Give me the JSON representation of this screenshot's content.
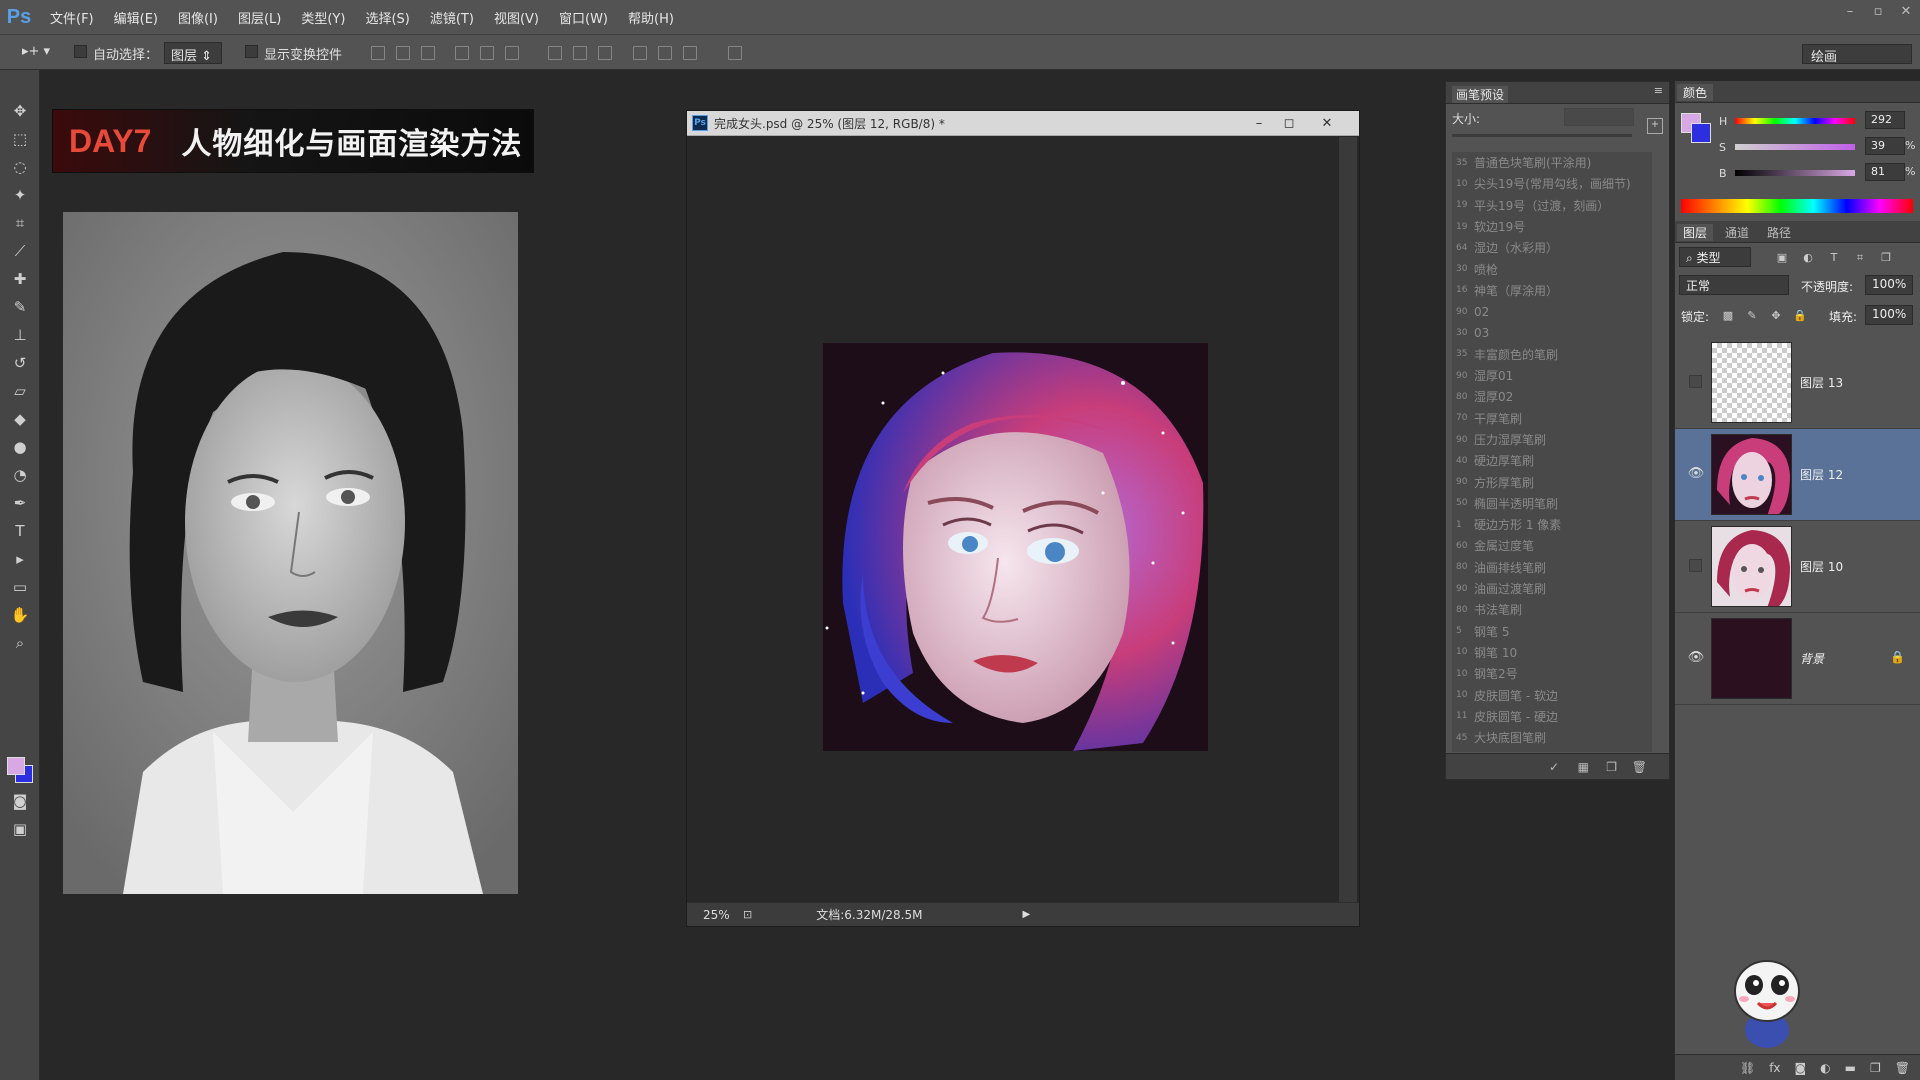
{
  "menubar": {
    "logo": "Ps",
    "items": [
      "文件(F)",
      "编辑(E)",
      "图像(I)",
      "图层(L)",
      "类型(Y)",
      "选择(S)",
      "滤镜(T)",
      "视图(V)",
      "窗口(W)",
      "帮助(H)"
    ]
  },
  "options": {
    "auto_select_label": "自动选择：",
    "auto_select_value": "图层",
    "show_transform_label": "显示变换控件",
    "workspace": "绘画"
  },
  "title_card": {
    "day": "DAY7",
    "text": "人物细化与画面渲染方法"
  },
  "document": {
    "title": "完成女头.psd @ 25% (图层 12, RGB/8) *",
    "zoom": "25%",
    "info": "文档:6.32M/28.5M"
  },
  "brush_panel": {
    "tab": "画笔预设",
    "size_label": "大小:",
    "brushes": [
      {
        "num": "35",
        "name": "普通色块笔刷(平涂用)"
      },
      {
        "num": "10",
        "name": "尖头19号(常用勾线，画细节)"
      },
      {
        "num": "19",
        "name": "平头19号（过渡，刻画）"
      },
      {
        "num": "19",
        "name": "软边19号"
      },
      {
        "num": "64",
        "name": "湿边（水彩用）"
      },
      {
        "num": "30",
        "name": "喷枪"
      },
      {
        "num": "16",
        "name": "神笔（厚涂用）"
      },
      {
        "num": "90",
        "name": "02"
      },
      {
        "num": "30",
        "name": "03"
      },
      {
        "num": "35",
        "name": "丰富颜色的笔刷"
      },
      {
        "num": "90",
        "name": "湿厚01"
      },
      {
        "num": "80",
        "name": "湿厚02"
      },
      {
        "num": "70",
        "name": "干厚笔刷"
      },
      {
        "num": "90",
        "name": "压力湿厚笔刷"
      },
      {
        "num": "40",
        "name": "硬边厚笔刷"
      },
      {
        "num": "90",
        "name": "方形厚笔刷"
      },
      {
        "num": "50",
        "name": "椭圆半透明笔刷"
      },
      {
        "num": "1",
        "name": "硬边方形 1 像素"
      },
      {
        "num": "60",
        "name": "金属过度笔"
      },
      {
        "num": "80",
        "name": "油画排线笔刷"
      },
      {
        "num": "90",
        "name": "油画过渡笔刷"
      },
      {
        "num": "80",
        "name": "书法笔刷"
      },
      {
        "num": "5",
        "name": "钢笔 5"
      },
      {
        "num": "10",
        "name": "钢笔 10"
      },
      {
        "num": "10",
        "name": "钢笔2号"
      },
      {
        "num": "10",
        "name": "皮肤圆笔 - 软边"
      },
      {
        "num": "11",
        "name": "皮肤圆笔 - 硬边"
      },
      {
        "num": "45",
        "name": "大块底图笔刷"
      }
    ]
  },
  "color_panel": {
    "tab": "颜色",
    "h_label": "H",
    "s_label": "S",
    "b_label": "B",
    "h_value": "292",
    "s_value": "39",
    "b_value": "81",
    "percent": "%",
    "foreground": "#d8a8e4",
    "background": "#2b2fe0"
  },
  "layers_panel": {
    "tabs": [
      "图层",
      "通道",
      "路径"
    ],
    "filter": "类型",
    "blend_mode": "正常",
    "opacity_label": "不透明度:",
    "opacity_value": "100%",
    "lock_label": "锁定:",
    "fill_label": "填充:",
    "fill_value": "100%",
    "layers": [
      {
        "name": "图层 13",
        "visible": false,
        "selected": false
      },
      {
        "name": "图层 12",
        "visible": true,
        "selected": true
      },
      {
        "name": "图层 10",
        "visible": false,
        "selected": false
      },
      {
        "name": "背景",
        "visible": true,
        "selected": false,
        "locked": true
      }
    ]
  }
}
